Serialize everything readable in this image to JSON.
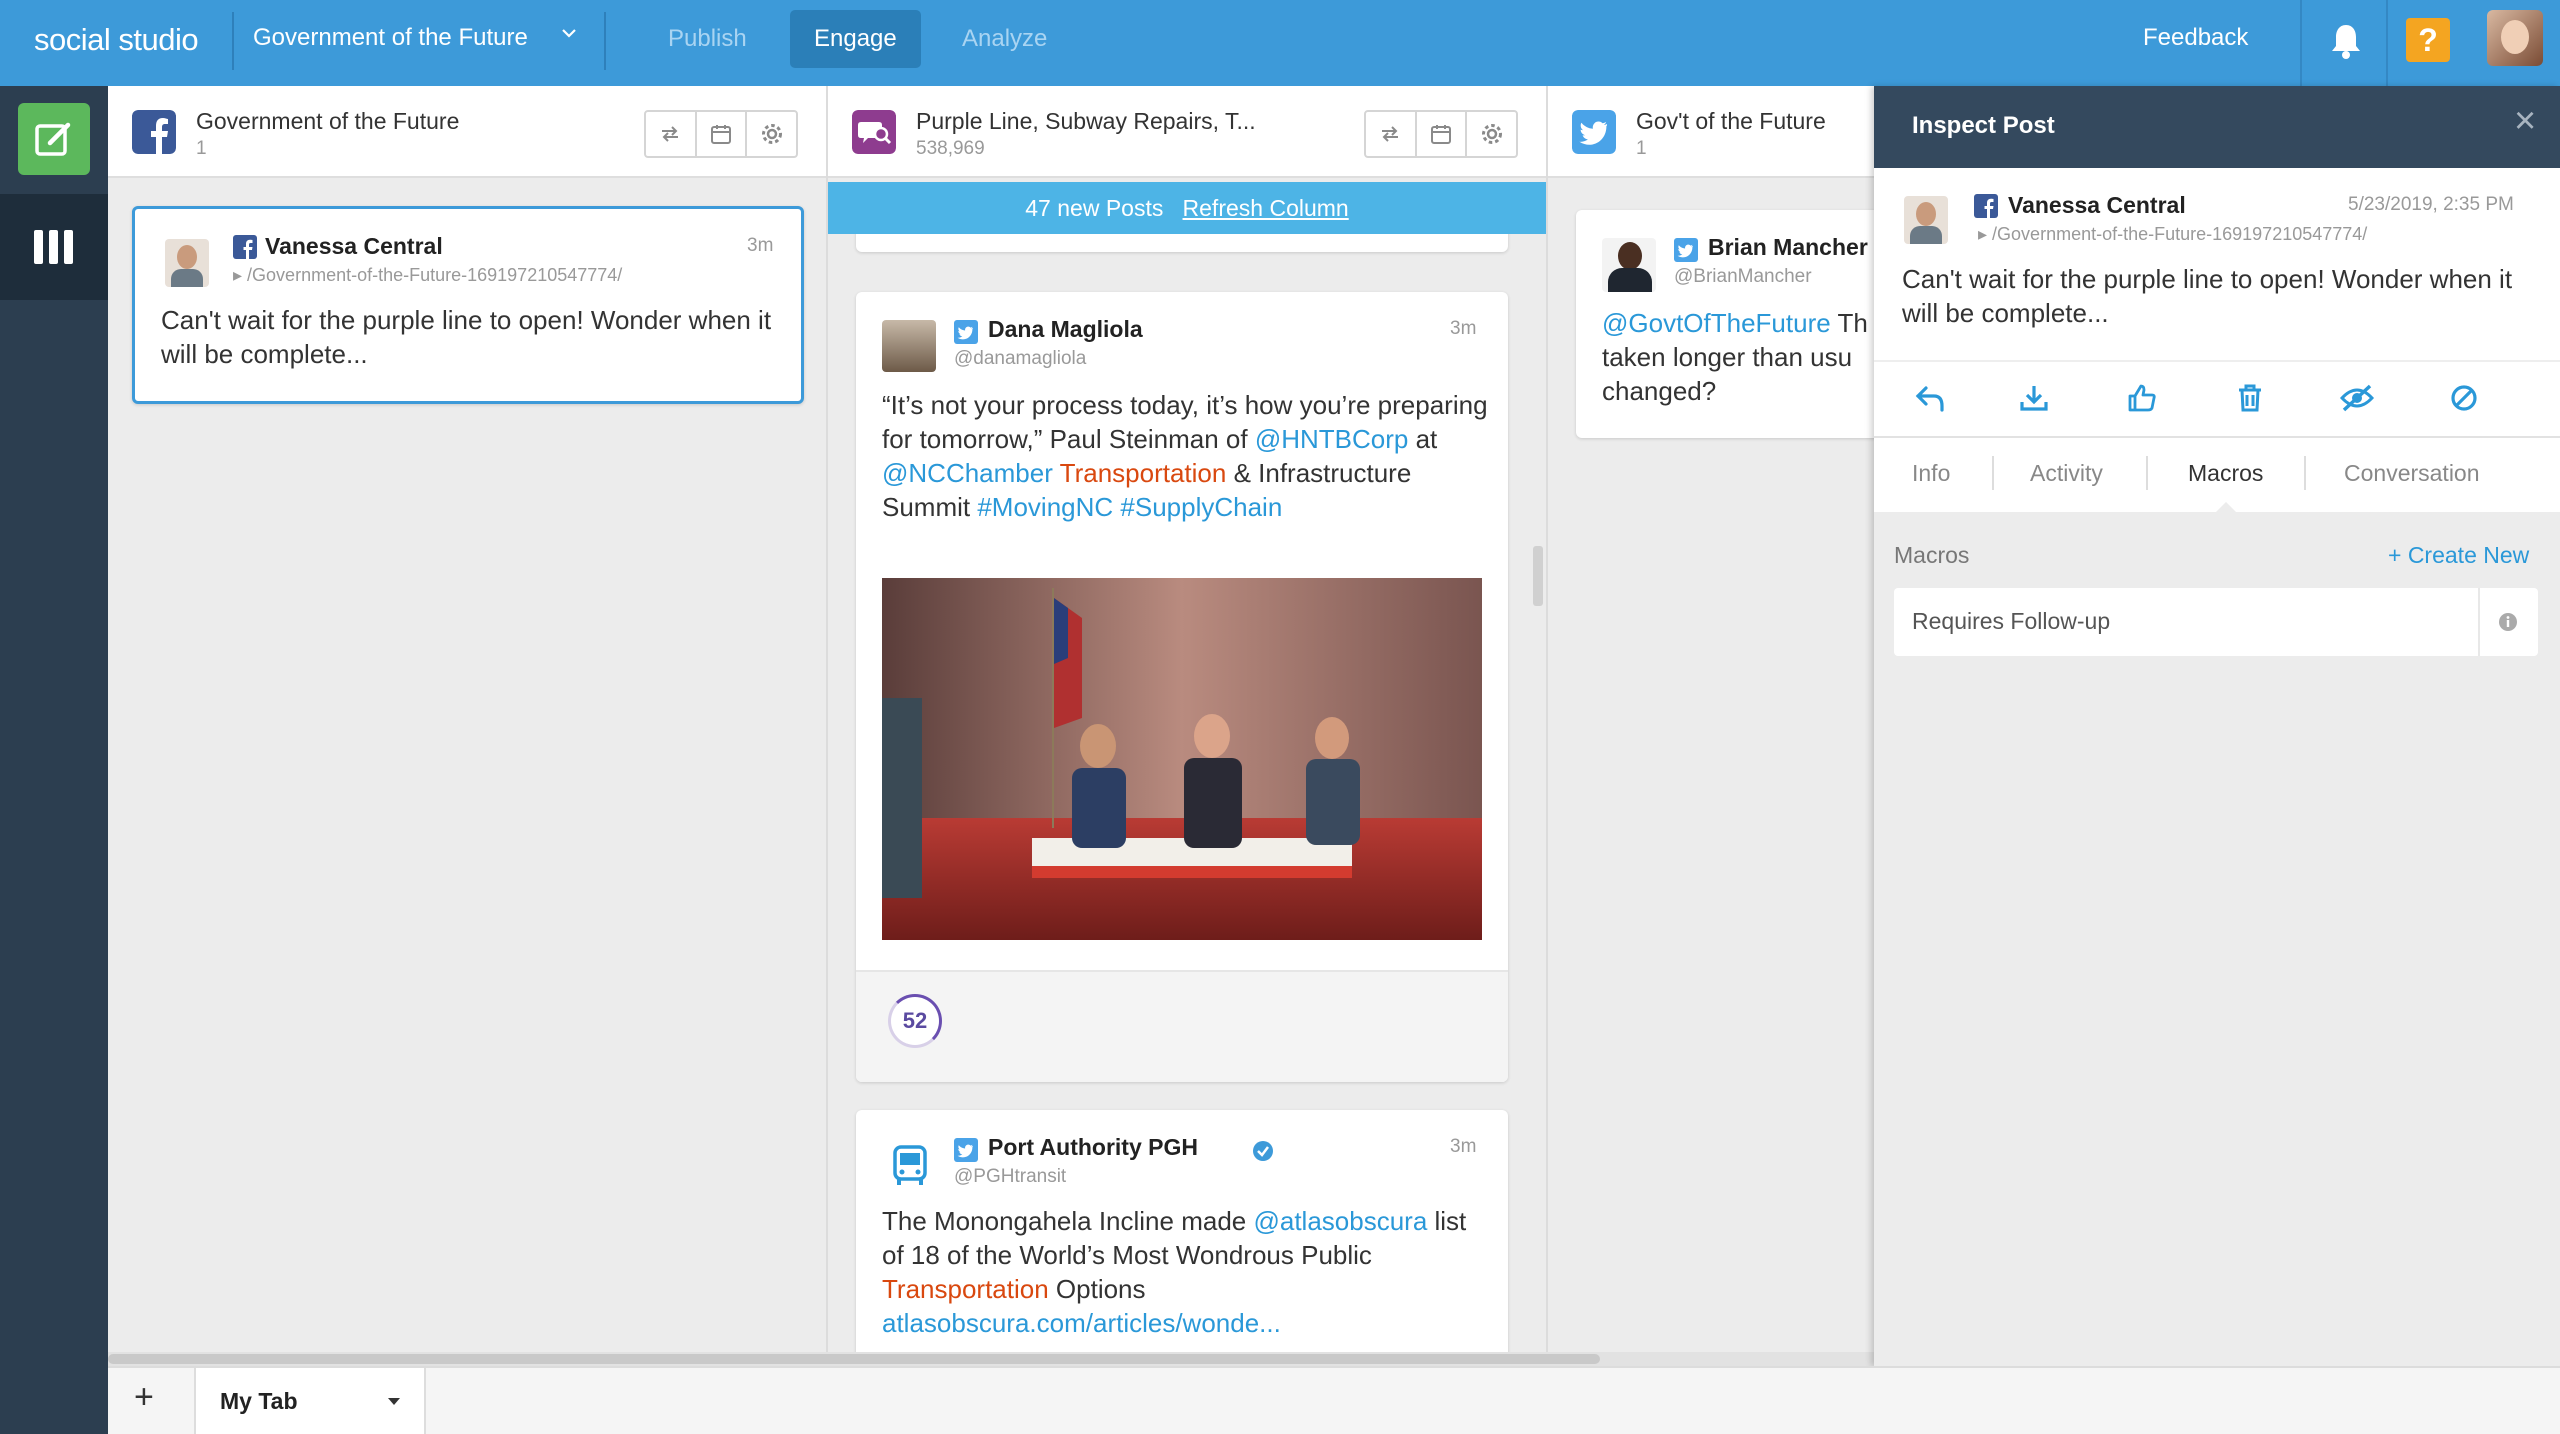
{
  "app": {
    "brand": "social studio",
    "workspace": "Government of the Future"
  },
  "nav": {
    "publish": "Publish",
    "engage": "Engage",
    "analyze": "Analyze"
  },
  "topbar": {
    "feedback": "Feedback",
    "help": "?"
  },
  "colors": {
    "topbar": "#3d9ad9",
    "rail": "#2c3e50",
    "compose": "#5cb85c",
    "link": "#2a98d8",
    "highlight": "#d9480f",
    "help": "#f4a521",
    "banner": "#4db4e6"
  },
  "columns": [
    {
      "title": "Government of the Future",
      "count": "1",
      "icon": "facebook-icon"
    },
    {
      "title": "Purple Line, Subway Repairs, T...",
      "count": "538,969",
      "icon": "search-topic-icon"
    },
    {
      "title": "Gov't of the Future",
      "count": "1",
      "icon": "twitter-icon"
    }
  ],
  "col1": {
    "post": {
      "user": "Vanessa Central",
      "path": "/Government-of-the-Future-169197210547774/",
      "time": "3m",
      "text": "Can't wait for the purple line to open! Wonder when it will be complete..."
    }
  },
  "col2": {
    "banner": {
      "text": "47 new Posts",
      "link": "Refresh Column"
    },
    "post1": {
      "user": "Dana Magliola",
      "handle": "@danamagliola",
      "time": "3m",
      "text_a": "“It’s not your process today, it’s how you’re preparing for tomorrow,” Paul Steinman of ",
      "m1": "@HNTBCorp",
      "t_at": " at ",
      "m2": "@NCChamber",
      "t_sp": " ",
      "kw": "Transportation",
      "t_amp": " & Infrastructure Summit ",
      "h1": "#MovingNC",
      "t_sp2": " ",
      "h2": "#SupplyChain",
      "score": "52"
    },
    "post2": {
      "user": "Port Authority PGH",
      "handle": "@PGHtransit",
      "time": "3m",
      "t_a": "The Monongahela Incline made ",
      "m1": "@atlasobscura",
      "t_b": " list of 18 of the World’s Most Wondrous Public ",
      "kw": "Transportation",
      "t_c": " Options ",
      "url": "atlasobscura.com/articles/wonde..."
    }
  },
  "col3": {
    "post": {
      "user": "Brian Mancher",
      "handle": "@BrianMancher",
      "mention": "@GovtOfTheFuture",
      "text_a": " Th",
      "text_b": "taken longer than usu",
      "text_c": "changed?"
    }
  },
  "inspect": {
    "title": "Inspect Post",
    "close": "×",
    "post": {
      "user": "Vanessa Central",
      "date": "5/23/2019, 2:35 PM",
      "path": "/Government-of-the-Future-169197210547774/",
      "text": "Can't wait for the purple line to open! Wonder when it will be complete..."
    },
    "tabs": [
      "Info",
      "Activity",
      "Macros",
      "Conversation"
    ],
    "macros": {
      "label": "Macros",
      "create": "+ Create New",
      "item": "Requires Follow-up"
    }
  },
  "bottom": {
    "add": "+",
    "tab": "My Tab"
  }
}
